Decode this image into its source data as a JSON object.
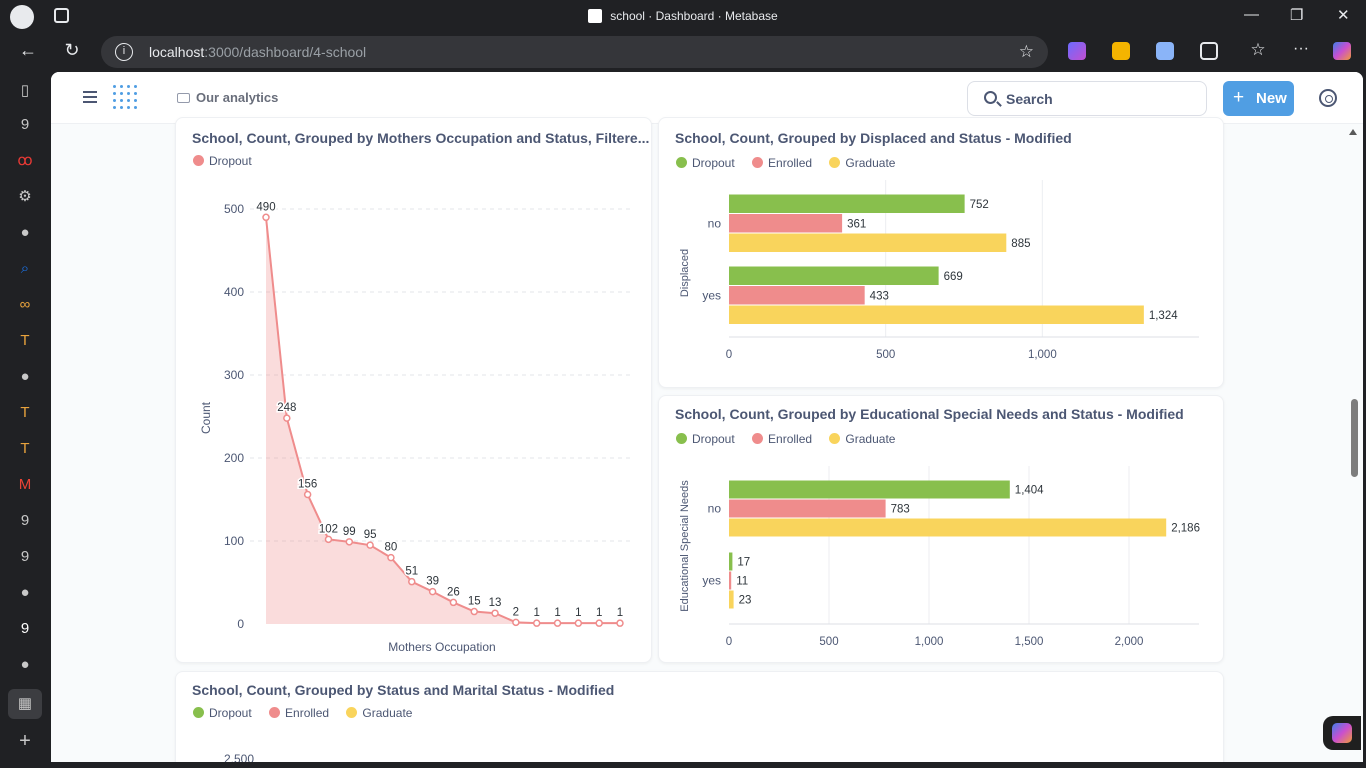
{
  "browser": {
    "tab_title": "school · Dashboard · Metabase",
    "url_host": "localhost",
    "url_path": ":3000/dashboard/4-school"
  },
  "metabase": {
    "breadcrumb": "Our analytics",
    "search_label": "Search",
    "new_button": "New"
  },
  "colors": {
    "dropout": "#88bf4d",
    "enrolled": "#ef8c8c",
    "graduate": "#f9d45c"
  },
  "cards": {
    "mothers": {
      "title": "School, Count, Grouped by Mothers Occupation and Status, Filtere...",
      "legend": [
        "Dropout"
      ],
      "xlabel": "Mothers Occupation",
      "ylabel": "Count"
    },
    "displaced": {
      "title": "School, Count, Grouped by Displaced and Status - Modified",
      "legend": [
        "Dropout",
        "Enrolled",
        "Graduate"
      ],
      "ylabel": "Displaced"
    },
    "special": {
      "title": "School, Count, Grouped by Educational Special Needs and Status - Modified",
      "legend": [
        "Dropout",
        "Enrolled",
        "Graduate"
      ],
      "ylabel": "Educational Special Needs"
    },
    "marital": {
      "title": "School, Count, Grouped by Status and Marital Status - Modified",
      "legend": [
        "Dropout",
        "Enrolled",
        "Graduate"
      ],
      "top_tick": "2,500"
    }
  },
  "chart_data": [
    {
      "type": "area",
      "title": "School, Count, Grouped by Mothers Occupation and Status, Filtere...",
      "xlabel": "Mothers Occupation",
      "ylabel": "Count",
      "series": [
        {
          "name": "Dropout",
          "values": [
            490,
            248,
            156,
            102,
            99,
            95,
            80,
            51,
            39,
            26,
            15,
            13,
            2,
            1,
            1,
            1,
            1,
            1
          ]
        }
      ],
      "ylim": [
        0,
        500
      ],
      "yticks": [
        0,
        100,
        200,
        300,
        400,
        500
      ],
      "grid": true
    },
    {
      "type": "bar",
      "orientation": "horizontal",
      "title": "School, Count, Grouped by Displaced and Status - Modified",
      "ylabel": "Displaced",
      "categories": [
        "no",
        "yes"
      ],
      "series": [
        {
          "name": "Dropout",
          "values": [
            752,
            669
          ]
        },
        {
          "name": "Enrolled",
          "values": [
            361,
            433
          ]
        },
        {
          "name": "Graduate",
          "values": [
            885,
            1324
          ]
        }
      ],
      "value_labels": [
        [
          "752",
          "361",
          "885"
        ],
        [
          "669",
          "433",
          "1,324"
        ]
      ],
      "xticks": [
        0,
        500,
        1000
      ],
      "xtick_labels": [
        "0",
        "500",
        "1,000"
      ],
      "xlim": [
        0,
        1500
      ]
    },
    {
      "type": "bar",
      "orientation": "horizontal",
      "title": "School, Count, Grouped by Educational Special Needs and Status - Modified",
      "ylabel": "Educational Special Needs",
      "categories": [
        "no",
        "yes"
      ],
      "series": [
        {
          "name": "Dropout",
          "values": [
            1404,
            17
          ]
        },
        {
          "name": "Enrolled",
          "values": [
            783,
            11
          ]
        },
        {
          "name": "Graduate",
          "values": [
            2186,
            23
          ]
        }
      ],
      "value_labels": [
        [
          "1,404",
          "783",
          "2,186"
        ],
        [
          "17",
          "11",
          "23"
        ]
      ],
      "xticks": [
        0,
        500,
        1000,
        1500,
        2000
      ],
      "xtick_labels": [
        "0",
        "500",
        "1,000",
        "1,500",
        "2,000"
      ],
      "xlim": [
        0,
        2350
      ]
    }
  ]
}
